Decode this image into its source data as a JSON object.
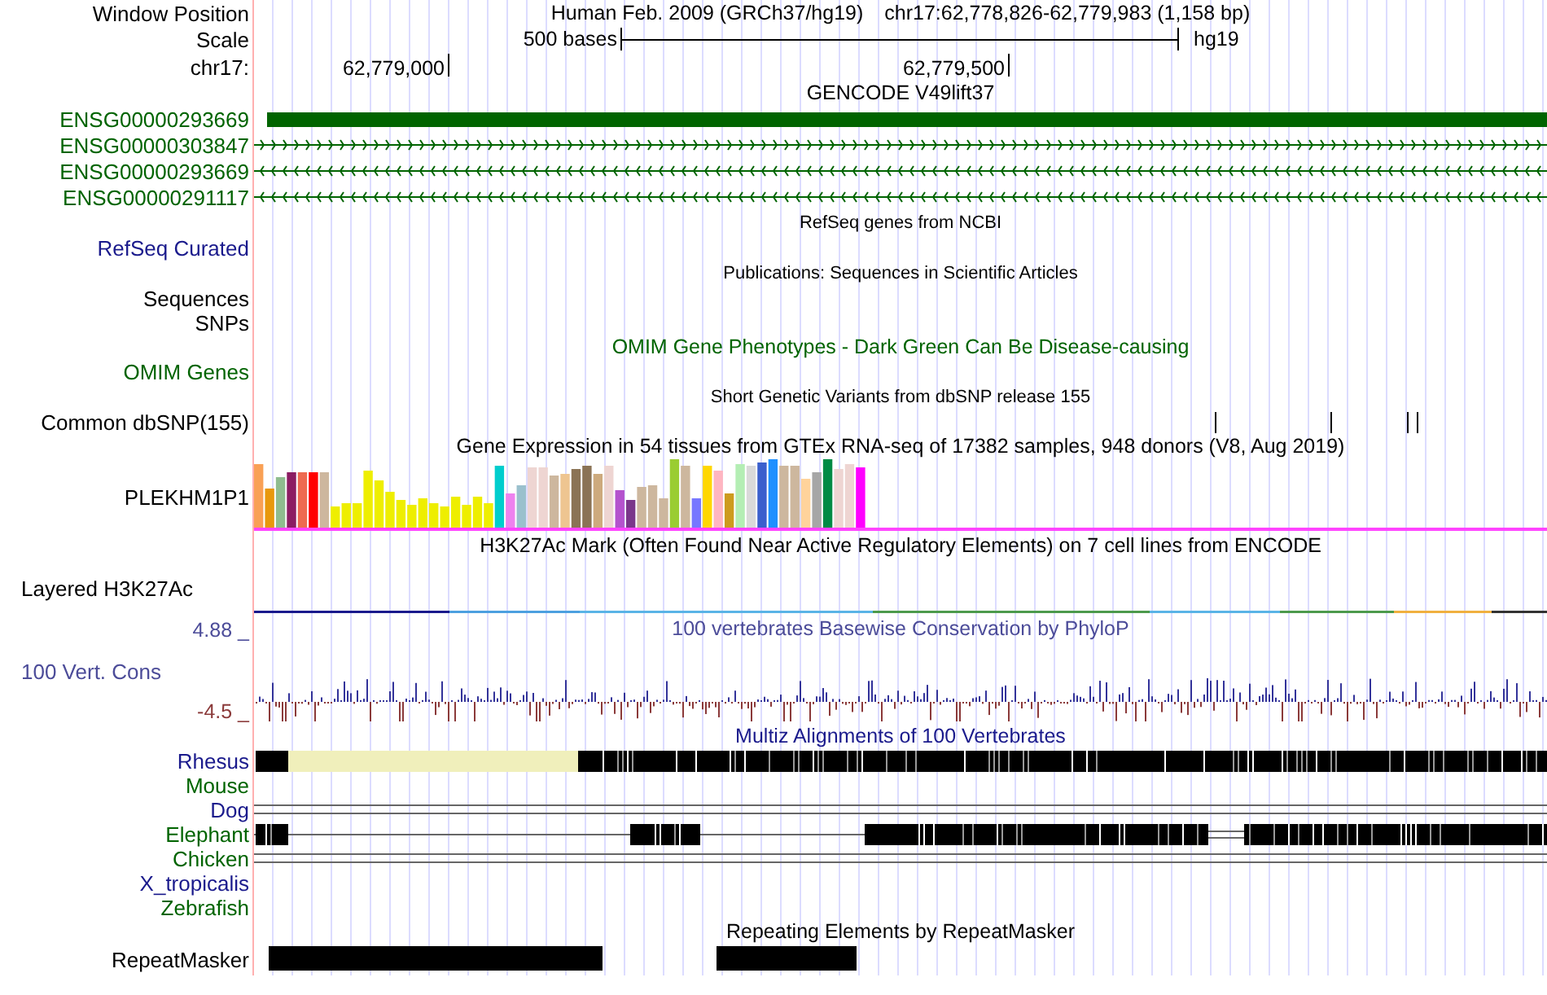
{
  "header": {
    "label": "Window Position",
    "title": "Human Feb. 2009 (GRCh37/hg19)",
    "position": "chr17:62,778,826-62,779,983 (1,158 bp)"
  },
  "scale": {
    "label": "Scale",
    "text": "500 bases",
    "assembly": "hg19"
  },
  "ruler": {
    "label": "chr17:",
    "ticks": [
      "62,779,000",
      "62,779,500"
    ]
  },
  "tracks": [
    {
      "kind": "title",
      "text": "GENCODE V49lift37",
      "color": "#000000"
    },
    {
      "kind": "gene-block",
      "label": "ENSG00000293669",
      "color": "#006400"
    },
    {
      "kind": "gene-forward",
      "label": "ENSG00000303847",
      "color": "#006400"
    },
    {
      "kind": "gene-reverse",
      "label": "ENSG00000293669",
      "color": "#006400"
    },
    {
      "kind": "gene-reverse",
      "label": "ENSG00000291117",
      "color": "#006400"
    },
    {
      "kind": "caption",
      "text": "RefSeq genes from NCBI",
      "color": "#000000"
    },
    {
      "kind": "empty",
      "label": "RefSeq Curated",
      "color": "#1a1a8c"
    },
    {
      "kind": "caption",
      "text": "Publications: Sequences in Scientific Articles",
      "color": "#000000"
    },
    {
      "kind": "empty",
      "label": "Sequences",
      "color": "#000000"
    },
    {
      "kind": "empty",
      "label": "SNPs",
      "color": "#000000"
    },
    {
      "kind": "title",
      "text": "OMIM Gene Phenotypes - Dark Green Can Be Disease-causing",
      "color": "#006400"
    },
    {
      "kind": "empty",
      "label": "OMIM Genes",
      "color": "#006400"
    },
    {
      "kind": "caption",
      "text": "Short Genetic Variants from dbSNP release 155",
      "color": "#000000"
    },
    {
      "kind": "snp",
      "label": "Common dbSNP(155)",
      "color": "#000000"
    },
    {
      "kind": "title",
      "text": "Gene Expression in 54 tissues from GTEx RNA-seq of 17382 samples, 948 donors (V8, Aug 2019)",
      "color": "#000000"
    },
    {
      "kind": "expression",
      "label": "PLEKHM1P1",
      "color": "#000000"
    },
    {
      "kind": "title",
      "text": "H3K27Ac Mark (Often Found Near Active Regulatory Elements) on 7 cell lines from ENCODE",
      "color": "#000000"
    },
    {
      "kind": "layered",
      "label": "Layered H3K27Ac",
      "color": "#000000"
    },
    {
      "kind": "wiggle",
      "title": "100 vertebrates Basewise Conservation by PhyloP",
      "label": "100 Vert. Cons",
      "max": "4.88 _",
      "min": "-4.5 _",
      "color": "#4c4c99"
    },
    {
      "kind": "title",
      "text": "Multiz Alignments of 100 Vertebrates",
      "color": "#1a1a8c"
    },
    {
      "kind": "align-full",
      "label": "Rhesus",
      "color": "#1a1a8c"
    },
    {
      "kind": "empty",
      "label": "Mouse",
      "color": "#006400"
    },
    {
      "kind": "align-double",
      "label": "Dog",
      "color": "#1a1a8c"
    },
    {
      "kind": "align-gapped",
      "label": "Elephant",
      "color": "#006400"
    },
    {
      "kind": "align-double",
      "label": "Chicken",
      "color": "#006400"
    },
    {
      "kind": "empty",
      "label": "X_tropicalis",
      "color": "#1a1a8c"
    },
    {
      "kind": "empty",
      "label": "Zebrafish",
      "color": "#006400"
    },
    {
      "kind": "title",
      "text": "Repeating Elements by RepeatMasker",
      "color": "#000000"
    },
    {
      "kind": "repeats",
      "label": "RepeatMasker",
      "color": "#000000"
    }
  ]
}
